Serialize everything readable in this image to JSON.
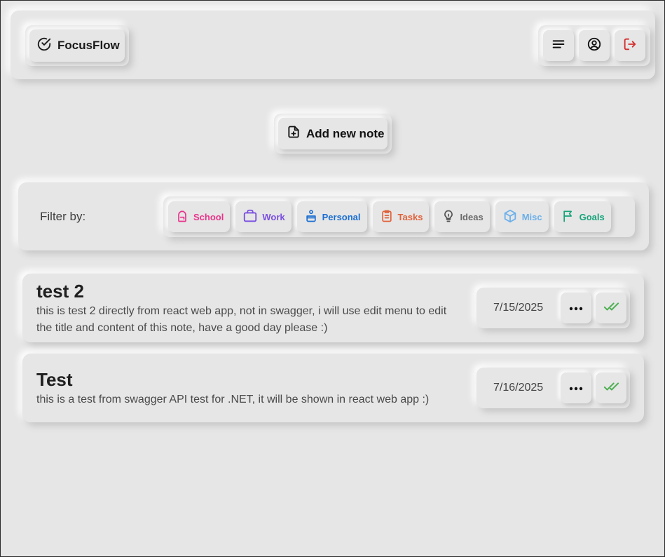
{
  "header": {
    "brand": "FocusFlow",
    "actions": [
      "menu-icon",
      "profile-icon",
      "logout-icon"
    ]
  },
  "add_note": {
    "label": "Add new note"
  },
  "filter": {
    "label": "Filter by:",
    "chips": [
      {
        "label": "School",
        "color": "#e8338a",
        "icon": "backpack-icon"
      },
      {
        "label": "Work",
        "color": "#7a4fe0",
        "icon": "briefcase-icon"
      },
      {
        "label": "Personal",
        "color": "#1a6fd1",
        "icon": "person-icon"
      },
      {
        "label": "Tasks",
        "color": "#e0613a",
        "icon": "clipboard-icon"
      },
      {
        "label": "Ideas",
        "color": "#6a6a6a",
        "icon": "lightbulb-icon"
      },
      {
        "label": "Misc",
        "color": "#6cb0ea",
        "icon": "box-icon"
      },
      {
        "label": "Goals",
        "color": "#16a37a",
        "icon": "flag-icon"
      }
    ]
  },
  "notes": [
    {
      "title": "test 2",
      "content": "this is test 2 directly from react web app, not in swagger, i will use edit menu to edit the title and content of this note, have a good day please :)",
      "date": "7/15/2025"
    },
    {
      "title": "Test",
      "content": "this is a test from swagger API test for .NET, it will be shown in react web app :)",
      "date": "7/16/2025"
    }
  ],
  "colors": {
    "check": "#4caf50",
    "logout": "#d32f2f"
  }
}
